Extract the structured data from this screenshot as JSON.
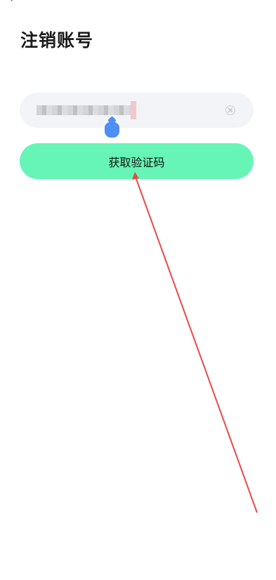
{
  "page": {
    "title": "注销账号"
  },
  "phone_input": {
    "value": "",
    "placeholder": ""
  },
  "icons": {
    "back": "chevron-left-icon",
    "clear": "clear-icon"
  },
  "button": {
    "label": "获取验证码"
  },
  "colors": {
    "button_bg": "#66f5b6",
    "input_bg": "#f2f4f7",
    "handle": "#4d8ff4",
    "annotation": "#e84a4a"
  }
}
